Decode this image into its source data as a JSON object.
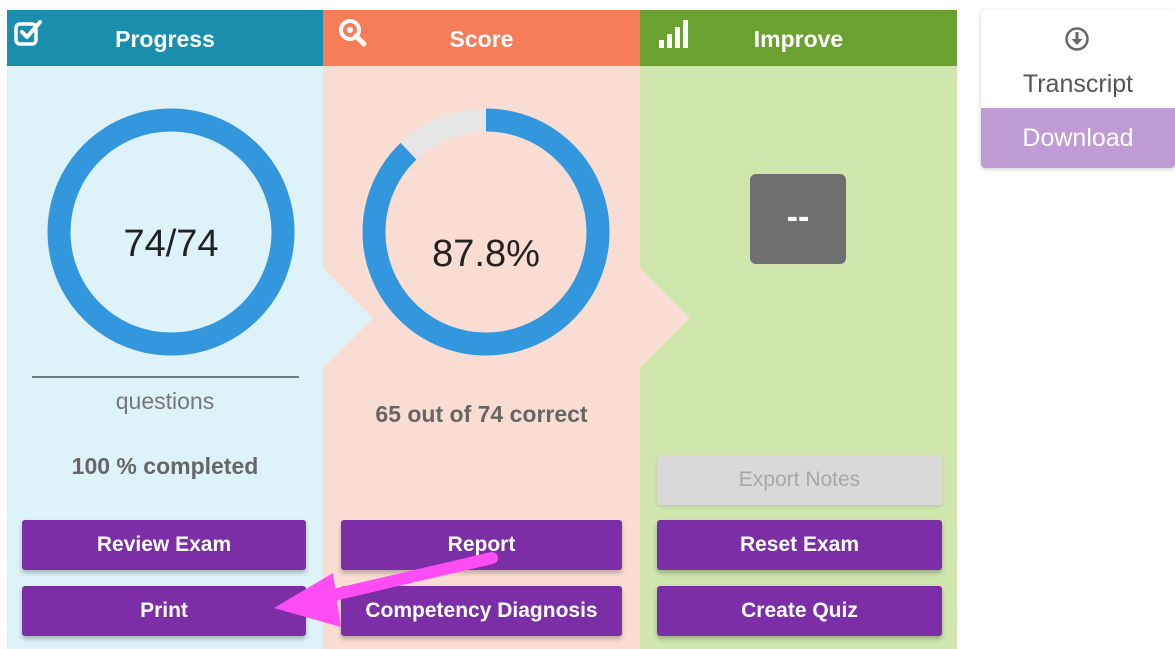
{
  "progress": {
    "title": "Progress",
    "ring_value": "74/74",
    "fraction": 1.0,
    "unit_label": "questions",
    "completed_text": "100 % completed",
    "buttons": [
      "Review Exam",
      "Print"
    ]
  },
  "score": {
    "title": "Score",
    "ring_value": "87.8%",
    "fraction": 0.878,
    "correct_text": "65 out of 74 correct",
    "buttons": [
      "Report",
      "Competency Diagnosis"
    ]
  },
  "improve": {
    "title": "Improve",
    "value": "--",
    "export_notes": "Export Notes",
    "buttons": [
      "Reset Exam",
      "Create Quiz"
    ]
  },
  "transcript": {
    "label": "Transcript",
    "download": "Download"
  },
  "colors": {
    "ring": "#3397de",
    "ring_track": "#e6e6e6",
    "button": "#7b2ea6",
    "annotation_arrow": "#ff4df5"
  }
}
